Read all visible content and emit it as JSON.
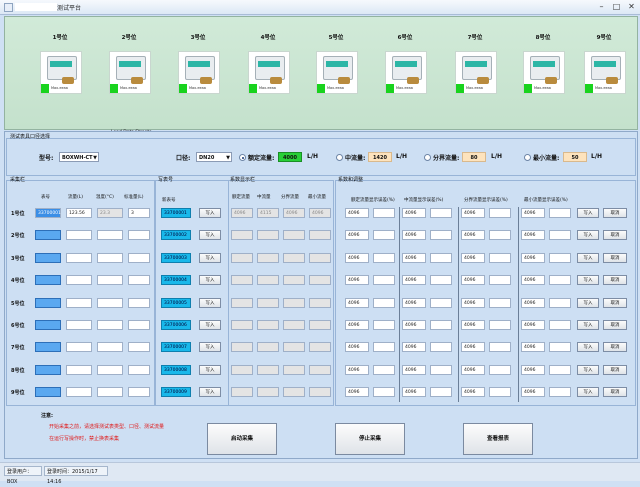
{
  "window": {
    "title": "测试平台",
    "icon": "app-icon",
    "controls": [
      "minimize-icon",
      "maximize-icon",
      "close-icon"
    ]
  },
  "meters": [
    {
      "label": "1号位",
      "text": "Max.eeaa"
    },
    {
      "label": "2号位",
      "text": "Max.eeaa"
    },
    {
      "label": "3号位",
      "text": "Max.eeaa"
    },
    {
      "label": "4号位",
      "text": "Max.eeaa"
    },
    {
      "label": "5号位",
      "text": "Max.eeaa"
    },
    {
      "label": "6号位",
      "text": "Max.eeaa"
    },
    {
      "label": "7号位",
      "text": "Max.eeaa"
    },
    {
      "label": "8号位",
      "text": "Max.eeaa"
    },
    {
      "label": "9号位",
      "text": "Max.eeaa"
    }
  ],
  "meter_caption": "Lead Data Streets",
  "config": {
    "group_title": "测试表具口径选择",
    "model_label": "型号:",
    "model_value": "BOXWH-CT",
    "caliber_label": "口径:",
    "caliber_value": "DN20",
    "rated_flow_label": "额定流量:",
    "rated_flow_value": "4000",
    "mid_flow_label": "中流量:",
    "mid_flow_value": "1420",
    "boundary_flow_label": "分界流量:",
    "boundary_flow_value": "80",
    "min_flow_label": "最小流量:",
    "min_flow_value": "50",
    "unit": "L/H"
  },
  "acquisition": {
    "title": "采集栏",
    "headers": [
      "表号",
      "流量(L)",
      "温度(°C)",
      "标准量(L)"
    ],
    "rows": [
      "1号位",
      "2号位",
      "3号位",
      "4号位",
      "5号位",
      "6号位",
      "7号位",
      "8号位",
      "9号位"
    ],
    "first_row": {
      "meter_no": "33700001",
      "flow": "123.56",
      "temp": "23.3",
      "std": "3"
    }
  },
  "write_meter": {
    "title": "写表号",
    "header": "新表号",
    "button": "写入",
    "ids": [
      "33700001",
      "33700002",
      "33700003",
      "33700004",
      "33700005",
      "33700006",
      "33700007",
      "33700008",
      "33700009"
    ]
  },
  "system_display": {
    "title": "系数显示栏",
    "headers": [
      "额定流量",
      "中流量",
      "分界流量",
      "最小流量"
    ],
    "values": [
      "4096",
      "4115",
      "4096",
      "4096"
    ]
  },
  "coefficient": {
    "title": "系数和调整",
    "headers": [
      "额定流量显示误差(%)",
      "中流量显示误差(%)",
      "分界流量显示误差(%)",
      "最小流量显示误差(%)"
    ],
    "value": "4096",
    "write_button": "写入",
    "cancel_button": "取消"
  },
  "notes": {
    "title": "注意:",
    "line1": "开始采集之前，请选择测试表类型、口径、测试流量",
    "line2": "在运行写操作时，禁止换表采集"
  },
  "actions": {
    "start": "启动采集",
    "stop": "停止采集",
    "report": "查看报表"
  },
  "status": {
    "user": "登录用户：BOX",
    "time": "登录时间：2015/1/17 14:16"
  }
}
